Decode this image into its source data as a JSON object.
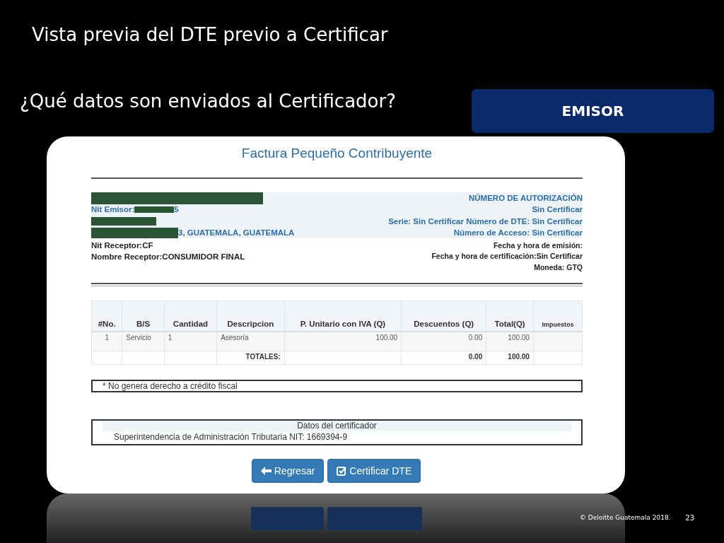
{
  "slide": {
    "title": "Vista previa del DTE previo a Certificar",
    "question": "¿Qué datos son enviados al Certificador?",
    "role_label": "EMISOR",
    "footer": "© Deloitte Guatemala 2018.",
    "page_number": "23"
  },
  "invoice": {
    "heading": "Factura Pequeño Contribuyente",
    "issuer_lines": [
      {
        "kind": "redacted"
      },
      {
        "kind": "label",
        "text": "Nit Emisor:",
        "tail": "5"
      },
      {
        "kind": "redacted"
      },
      {
        "kind": "address",
        "text": "3, GUATEMALA, GUATEMALA"
      }
    ],
    "authorization_lines": [
      "NÚMERO DE AUTORIZACIÓN",
      "Sin Certificar",
      "Serie: Sin Certificar Número de DTE: Sin Certificar",
      "Número de Acceso: Sin Certificar"
    ],
    "receiver_lines": [
      "Nit Receptor:CF",
      "Nombre Receptor:CONSUMIDOR FINAL"
    ],
    "date_lines": [
      "Fecha y hora de emisión:",
      "Fecha y hora de certificación:Sin Certificar",
      "Moneda: GTQ"
    ],
    "table": {
      "columns": [
        "#No.",
        "B/S",
        "Cantidad",
        "Descripcion",
        "P. Unitario con IVA (Q)",
        "Descuentos (Q)",
        "Total(Q)",
        "Impuestos"
      ],
      "rows": [
        [
          "1",
          "Servicio",
          "1",
          "Asesoría",
          "100.00",
          "0.00",
          "100.00",
          ""
        ]
      ],
      "totals": {
        "label": "TOTALES:",
        "discounts": "0.00",
        "total": "100.00"
      }
    },
    "note": "* No genera derecho a crédito fiscal",
    "certifier": {
      "heading": "Datos del certificador",
      "text": "Superintendencia de Administración Tributaria NIT: 1669394-9"
    },
    "buttons": [
      {
        "kind": "back",
        "label": "Regresar"
      },
      {
        "kind": "certify",
        "label": "Certificar DTE"
      }
    ]
  }
}
